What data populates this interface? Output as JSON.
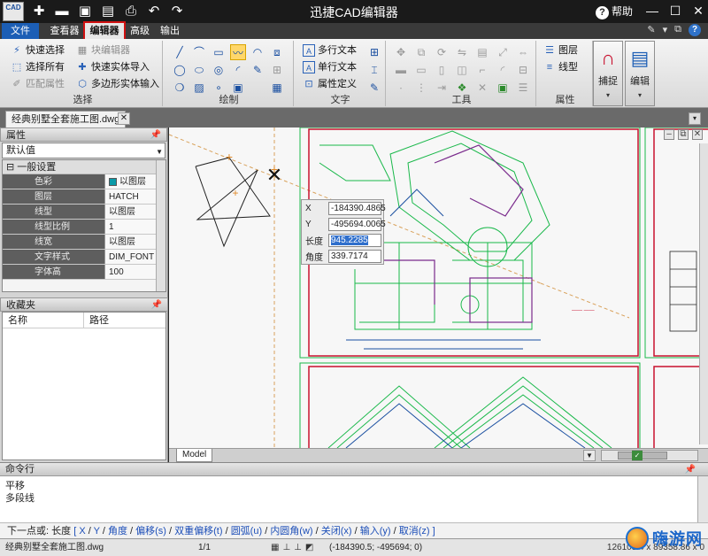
{
  "titlebar": {
    "logo_text": "CAD",
    "title": "迅捷CAD编辑器",
    "help": "帮助"
  },
  "menu": {
    "file": "文件",
    "viewer": "查看器",
    "editor": "编辑器",
    "advanced": "高级",
    "output": "输出"
  },
  "ribbon": {
    "select": {
      "label": "选择",
      "quick_select": "快速选择",
      "select_all": "选择所有",
      "match_props": "匹配属性",
      "block_editor": "块编辑器",
      "quick_entity_import": "快速实体导入",
      "polygon_entity_input": "多边形实体输入"
    },
    "draw": {
      "label": "绘制"
    },
    "text": {
      "label": "文字",
      "multiline": "多行文本",
      "singleline": "单行文本",
      "attr_def": "属性定义"
    },
    "tools": {
      "label": "工具"
    },
    "props": {
      "label": "属性",
      "layer": "图层",
      "linetype": "线型"
    },
    "snap": "捕捉",
    "edit": "编辑"
  },
  "document": {
    "tab": "经典别墅全套施工图.dwg"
  },
  "properties_panel": {
    "title": "属性",
    "dropdown": "默认值",
    "group": "一般设置",
    "rows": [
      {
        "key": "色彩",
        "value": "以图层"
      },
      {
        "key": "图层",
        "value": "HATCH"
      },
      {
        "key": "线型",
        "value": "以图层"
      },
      {
        "key": "线型比例",
        "value": "1"
      },
      {
        "key": "线宽",
        "value": "以图层"
      },
      {
        "key": "文字样式",
        "value": "DIM_FONT"
      },
      {
        "key": "字体高",
        "value": "100"
      }
    ]
  },
  "favorites_panel": {
    "title": "收藏夹",
    "col_name": "名称",
    "col_path": "路径"
  },
  "coords": {
    "x_label": "X",
    "x_value": "-184390.4865",
    "y_label": "Y",
    "y_value": "-495694.0065",
    "length_label": "长度",
    "length_value": "945.2285",
    "angle_label": "角度",
    "angle_value": "339.7174"
  },
  "model_tab": "Model",
  "command": {
    "title": "命令行",
    "history": [
      "平移",
      "多段线"
    ],
    "prompt_prefix": "下一点或:",
    "prompt_current": "长度",
    "options": [
      "X",
      "Y",
      "角度",
      "偏移(s)",
      "双重偏移(t)",
      "圆弧(u)",
      "内圆角(w)",
      "关闭(x)",
      "输入(y)",
      "取消(z)"
    ]
  },
  "status": {
    "file": "经典别墅全套施工图.dwg",
    "page": "1/1",
    "coords": "(-184390.5; -495694; 0)",
    "size": "126103.4 x 89358.86 x 0"
  },
  "watermark": "嗨游网",
  "colors": {
    "accent": "#1c5eb5",
    "highlight": "#d01010",
    "titlebar": "#1a1a1a",
    "cad_green": "#19b84a",
    "cad_red": "#c8102e"
  }
}
